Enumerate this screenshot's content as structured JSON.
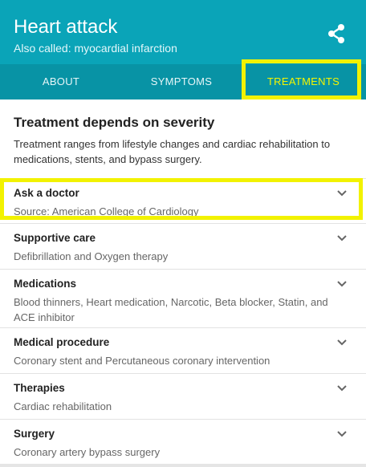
{
  "header": {
    "title": "Heart attack",
    "subtitle": "Also called: myocardial infarction",
    "share_icon": "share-icon",
    "background": "#0aa4b8"
  },
  "tabs": [
    {
      "label": "ABOUT",
      "selected": false
    },
    {
      "label": "SYMPTOMS",
      "selected": false
    },
    {
      "label": "TREATMENTS",
      "selected": true
    }
  ],
  "intro": {
    "heading": "Treatment depends on severity",
    "body": "Treatment ranges from lifestyle changes and cardiac rehabilitation to medications, stents, and bypass surgery."
  },
  "rows": [
    {
      "title": "Ask a doctor",
      "subtitle": "Source: American College of Cardiology"
    },
    {
      "title": "Supportive care",
      "subtitle": "Defibrillation and Oxygen therapy"
    },
    {
      "title": "Medications",
      "subtitle": "Blood thinners, Heart medication, Narcotic, Beta blocker, Statin, and ACE inhibitor"
    },
    {
      "title": "Medical procedure",
      "subtitle": "Coronary stent and Percutaneous coronary intervention"
    },
    {
      "title": "Therapies",
      "subtitle": "Cardiac rehabilitation"
    },
    {
      "title": "Surgery",
      "subtitle": "Coronary artery bypass surgery"
    }
  ],
  "colors": {
    "highlight": "#f2f200",
    "tab_bar": "#0893a5",
    "selected_tab_text": "#f4f400"
  }
}
